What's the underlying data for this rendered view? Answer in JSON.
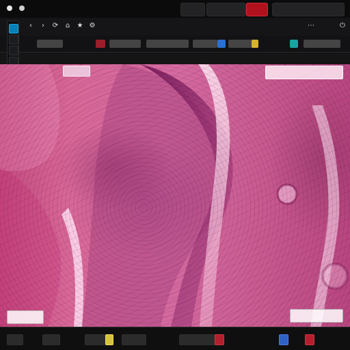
{
  "toolbar": {
    "title": ""
  },
  "viewer": {
    "header_label": ""
  },
  "icons": {
    "top_system": [
      "app-icon",
      "tab-icon",
      "tab-icon",
      "alert-icon"
    ],
    "toolbar": [
      "back-icon",
      "forward-icon",
      "refresh-icon",
      "home-icon",
      "bookmark-icon",
      "settings-icon",
      "extensions-icon",
      "power-icon"
    ],
    "left_toolbar": [
      "pointer-tool-icon",
      "hand-tool-icon",
      "zoom-tool-icon",
      "rectangle-tool-icon",
      "ellipse-tool-icon",
      "polygon-tool-icon",
      "brush-tool-icon",
      "eraser-tool-icon",
      "measure-tool-icon",
      "annotation-tool-icon",
      "layers-tool-icon",
      "color-tool-icon"
    ],
    "taskbar": [
      "taskbar-item-icon",
      "taskbar-item-icon",
      "taskbar-item-icon",
      "taskbar-item-icon",
      "taskbar-item-icon",
      "taskbar-item-icon",
      "taskbar-item-icon",
      "taskbar-item-icon",
      "taskbar-item-icon"
    ]
  },
  "colors": {
    "accent_blue": "#2b6fd1",
    "accent_teal": "#1aa3a0",
    "accent_red": "#b41f2d",
    "tissue_pink": "#d56aa0",
    "tissue_dark": "#7a1f5f"
  }
}
